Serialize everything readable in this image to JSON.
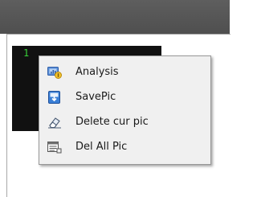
{
  "window": {
    "picture_index": "1"
  },
  "context_menu": {
    "items": [
      {
        "label": "Analysis",
        "icon": "analysis-icon"
      },
      {
        "label": "SavePic",
        "icon": "save-icon"
      },
      {
        "label": "Delete cur pic",
        "icon": "eraser-icon"
      },
      {
        "label": "Del All Pic",
        "icon": "delete-all-icon"
      }
    ]
  },
  "colors": {
    "titlebar": "#575757",
    "viewer_background": "#111111",
    "index_text": "#38d238",
    "menu_background": "#f0f0f0"
  }
}
